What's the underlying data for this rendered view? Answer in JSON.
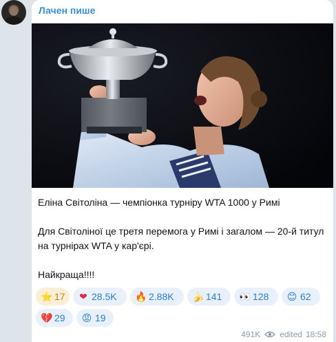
{
  "channel": {
    "author": "Лачен пише",
    "avatar": "channel-avatar"
  },
  "post": {
    "image": "photo of player holding trophy",
    "lines": [
      "Еліна Світоліна — чемпіонка турніру WTA 1000 у Римі",
      "Для Світоліної це третя перемога у Римі і загалом — 20-й титул на турнірах WTA у кар'єрі.",
      "Найкраща!!!!"
    ]
  },
  "reactions": [
    {
      "emoji": "⭐",
      "icon": "star-icon",
      "count": "17",
      "paid": true
    },
    {
      "emoji": "❤",
      "icon": "heart-icon",
      "count": "28.5K"
    },
    {
      "emoji": "🔥",
      "icon": "fire-icon",
      "count": "2.88K"
    },
    {
      "emoji": "🍌",
      "icon": "banana-icon",
      "count": "141"
    },
    {
      "emoji": "👀",
      "icon": "eyes-icon",
      "count": "128"
    },
    {
      "emoji": "😊",
      "icon": "smile-icon",
      "count": "62"
    },
    {
      "emoji": "💔",
      "icon": "broken-heart-icon",
      "count": "29"
    },
    {
      "emoji": "😡",
      "icon": "angry-face-icon",
      "count": "19"
    }
  ],
  "meta": {
    "views": "491K",
    "views_icon": "eye-icon",
    "edited_label": "edited",
    "time": "18:58"
  },
  "colors": {
    "author": "#3b8fcf",
    "reaction_bg": "#e8f1fb",
    "reaction_text": "#2f7cc1",
    "paid_bg": "#fbf0d6",
    "paid_text": "#b98416",
    "chat_bg": "#dde4ea"
  }
}
